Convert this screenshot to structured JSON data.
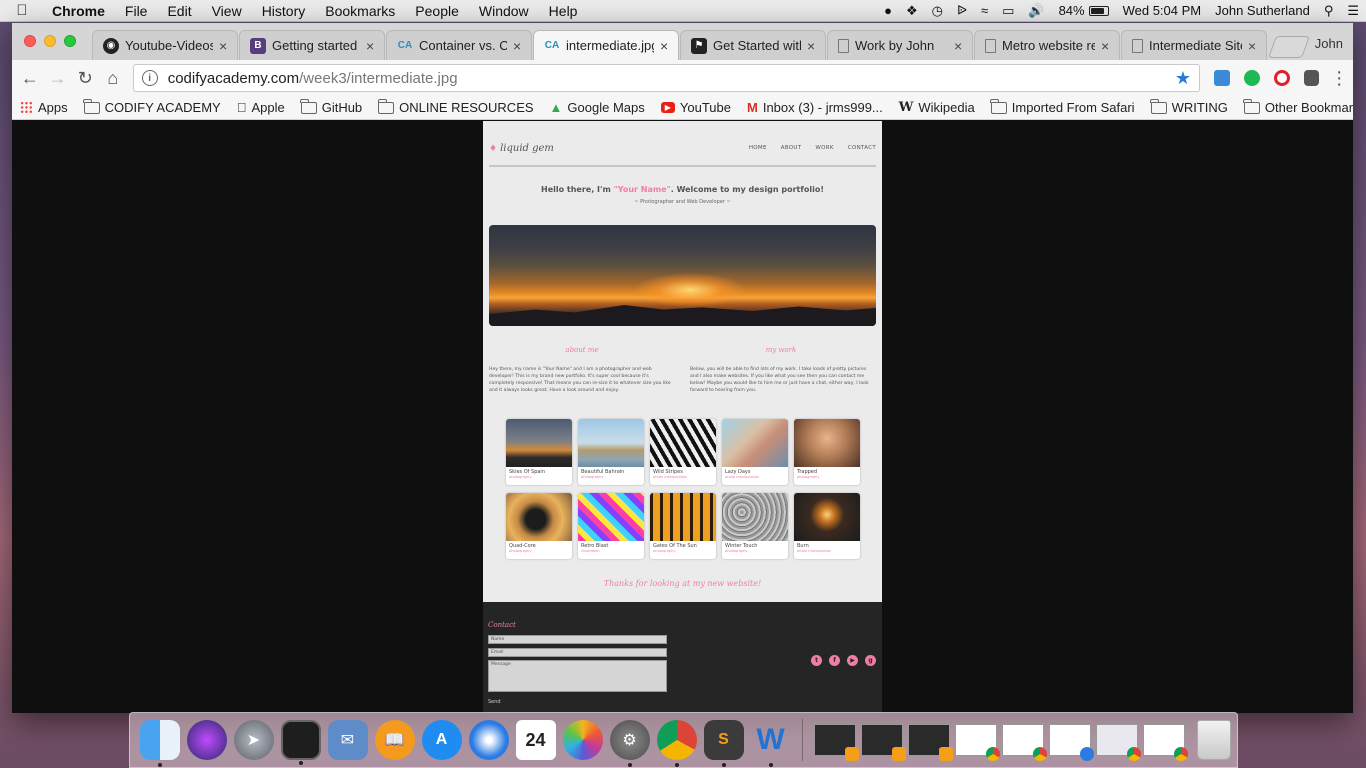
{
  "menubar": {
    "app": "Chrome",
    "items": [
      "File",
      "Edit",
      "View",
      "History",
      "Bookmarks",
      "People",
      "Window",
      "Help"
    ],
    "battery": "84%",
    "battery_level": 0.84,
    "clock": "Wed 5:04 PM",
    "user": "John Sutherland"
  },
  "browser": {
    "tabs": [
      {
        "title": "Youtube-Videos",
        "icon": "github-icon",
        "active": false
      },
      {
        "title": "Getting started",
        "icon": "bootstrap-icon",
        "active": false
      },
      {
        "title": "Container vs. Co",
        "icon": "ca-icon",
        "active": false
      },
      {
        "title": "intermediate.jpg",
        "icon": "ca-icon",
        "active": true
      },
      {
        "title": "Get Started with",
        "icon": "flag-icon",
        "active": false
      },
      {
        "title": "Work by John",
        "icon": "page-icon",
        "active": false
      },
      {
        "title": "Metro website re",
        "icon": "page-icon",
        "active": false
      },
      {
        "title": "Intermediate Site",
        "icon": "page-icon",
        "active": false
      }
    ],
    "profile": "John",
    "url_host": "codifyacademy.com",
    "url_path": "/week3/intermediate.jpg",
    "bookmarks": [
      "Apps",
      "CODIFY ACADEMY",
      "Apple",
      "GitHub",
      "ONLINE RESOURCES",
      "Google Maps",
      "YouTube",
      "Inbox (3) - jrms999...",
      "Wikipedia",
      "Imported From Safari",
      "WRITING"
    ],
    "other_bookmarks": "Other Bookmarks"
  },
  "page": {
    "logo": "liquid gem",
    "nav": [
      "HOME",
      "ABOUT",
      "WORK",
      "CONTACT"
    ],
    "hello_pre": "Hello there, I'm ",
    "hello_name": "\"Your Name\"",
    "hello_post": ". Welcome to my design portfolio!",
    "subtitle": "~ Photographer and Web Developer ~",
    "about_heading": "about me",
    "about_text": "Hey there, my name is \"Your Name\" and I am a photographer and web developer! This is my brand new portfolio. It's super cool because it's completely responsive! That means you can re-size it to whatever size you like and it always looks great. Have a look around and enjoy.",
    "work_heading": "my work",
    "work_text": "Below, you will be able to find lots of my work. I take loads of pretty pictures and I also make websites. If you like what you see then you can contact me below! Maybe you would like to hire me or just have a chat, either way, I look forward to hearing from you.",
    "gallery": [
      {
        "name": "Skies Of Spain",
        "category": "photography"
      },
      {
        "name": "Beautiful Bahrain",
        "category": "photography"
      },
      {
        "name": "Wild Stripes",
        "category": "photo manipulation"
      },
      {
        "name": "Lazy Days",
        "category": "photo manipulation"
      },
      {
        "name": "Trapped",
        "category": "photography"
      },
      {
        "name": "Quad-Core",
        "category": "photography"
      },
      {
        "name": "Retro Blast",
        "category": "illustration"
      },
      {
        "name": "Gates Of The Sun",
        "category": "photography"
      },
      {
        "name": "Winter Touch",
        "category": "photography"
      },
      {
        "name": "Burn",
        "category": "photo manipulation"
      }
    ],
    "thanks": "Thanks for looking at my new website!",
    "contact_heading": "Contact",
    "name_placeholder": "Name",
    "email_placeholder": "Email",
    "message_placeholder": "Message",
    "send": "Send"
  },
  "colors": {
    "accent_pink": "#ee7fa3",
    "footer_bg": "#252525",
    "page_bg": "#ebebeb"
  }
}
